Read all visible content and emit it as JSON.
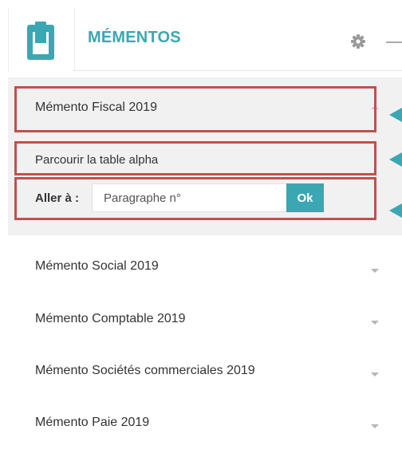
{
  "header": {
    "title": "MÉMENTOS",
    "logo_icon": "book-icon",
    "settings_icon": "gear-icon",
    "minimize_icon": "minus-icon"
  },
  "expanded_item": {
    "label": "Mémento Fiscal 2019",
    "browse_link": "Parcourir la table alpha",
    "goto_label": "Aller à :",
    "paragraph_input": {
      "placeholder": "Paragraphe n°",
      "value": ""
    },
    "ok_label": "Ok"
  },
  "items": [
    {
      "label": "Mémento Social 2019"
    },
    {
      "label": "Mémento Comptable 2019"
    },
    {
      "label": "Mémento Sociétés commerciales 2019"
    },
    {
      "label": "Mémento Paie 2019"
    }
  ],
  "colors": {
    "accent": "#3aa7b2",
    "annotation_box": "#c0504d",
    "panel_bg": "#f1f1f1"
  }
}
